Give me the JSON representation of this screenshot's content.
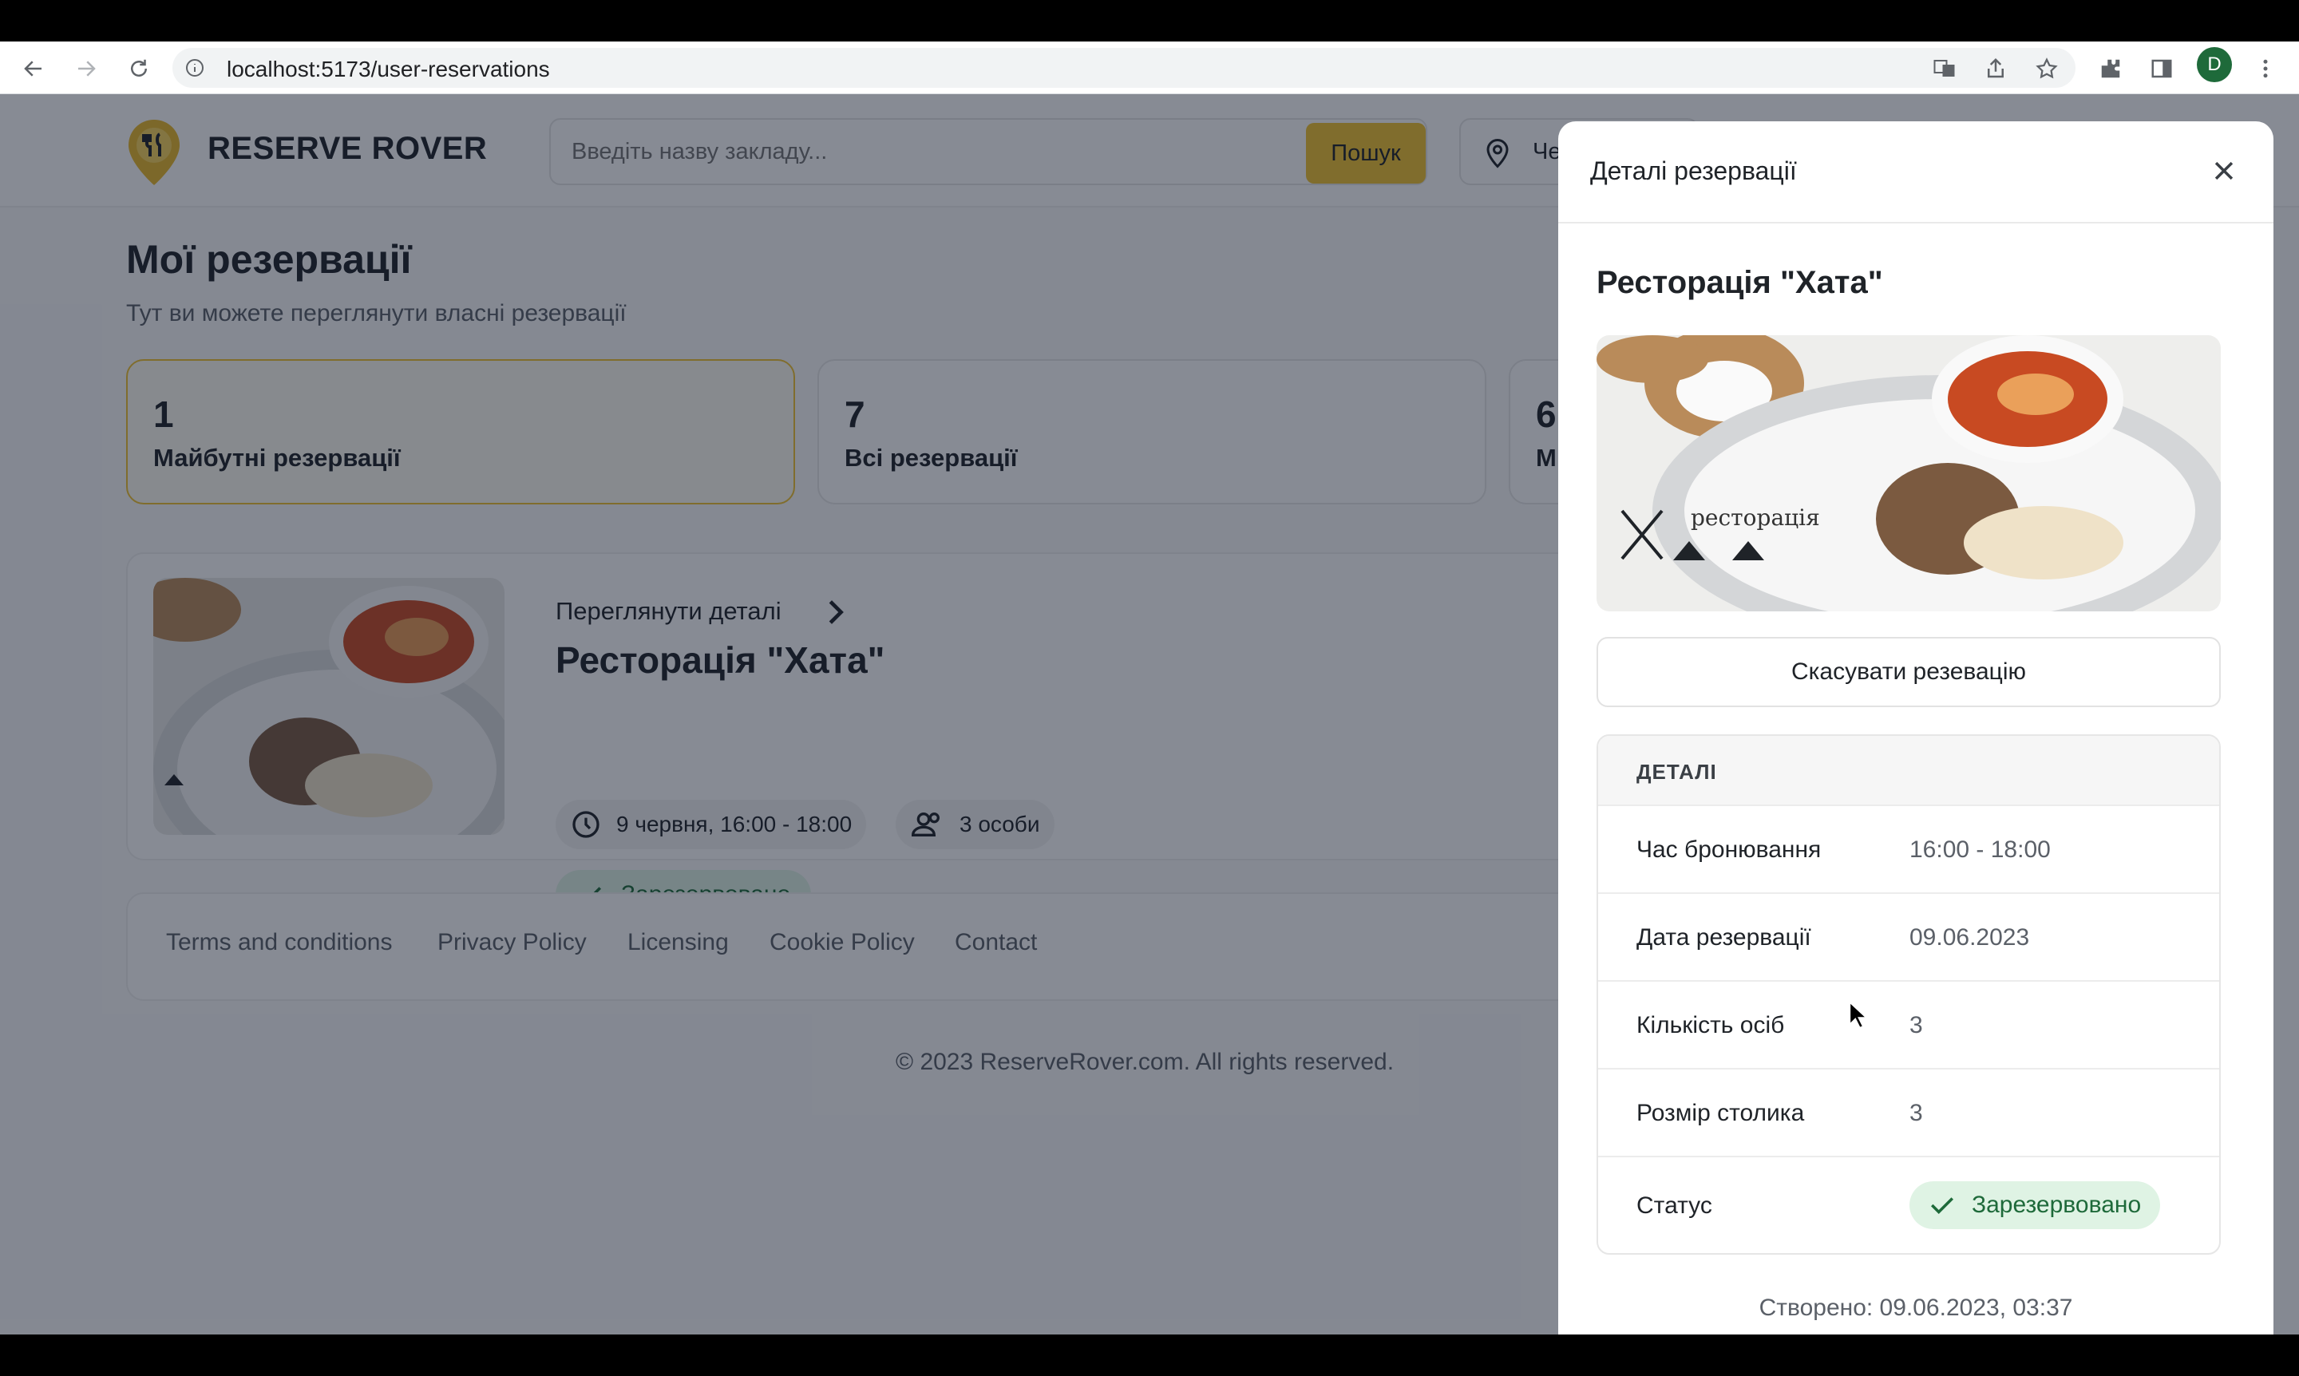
{
  "browser": {
    "url": "localhost:5173/user-reservations",
    "profile_initial": "D"
  },
  "header": {
    "brand": "RESERVE ROVER",
    "search_placeholder": "Введіть назву закладу...",
    "search_button": "Пошук",
    "location_text": "Че"
  },
  "page": {
    "title": "Мої резервації",
    "subtitle": "Тут ви можете переглянути власні резервації"
  },
  "stats": [
    {
      "num": "1",
      "label": "Майбутні резервації"
    },
    {
      "num": "7",
      "label": "Всі резервації"
    },
    {
      "num": "6",
      "label": "Ми"
    }
  ],
  "reservation_card": {
    "link": "Переглянути деталі",
    "title": "Ресторація \"Хата\"",
    "datetime": "9 червня, 16:00 - 18:00",
    "guests": "3 особи",
    "status": "Зарезервовано"
  },
  "footer": {
    "links": [
      "Terms and conditions",
      "Privacy Policy",
      "Licensing",
      "Cookie Policy",
      "Contact"
    ],
    "copyright": "© 2023 ReserveRover.com. All rights reserved."
  },
  "drawer": {
    "title": "Деталі резервації",
    "restaurant": "Ресторація \"Хата\"",
    "image_logo_text": "ресторація",
    "cancel_button": "Скасувати резевацію",
    "details_header": "ДЕТАЛІ",
    "rows": [
      {
        "key": "Час бронювання",
        "value": "16:00 - 18:00"
      },
      {
        "key": "Дата резервації",
        "value": "09.06.2023"
      },
      {
        "key": "Кількість осіб",
        "value": "3"
      },
      {
        "key": "Розмір столика",
        "value": "3"
      }
    ],
    "status_key": "Статус",
    "status_value": "Зарезервовано",
    "created": "Створено: 09.06.2023, 03:37"
  },
  "colors": {
    "accent": "#f0c330",
    "status_bg": "#dff3e4",
    "status_text": "#1e6a3a"
  }
}
